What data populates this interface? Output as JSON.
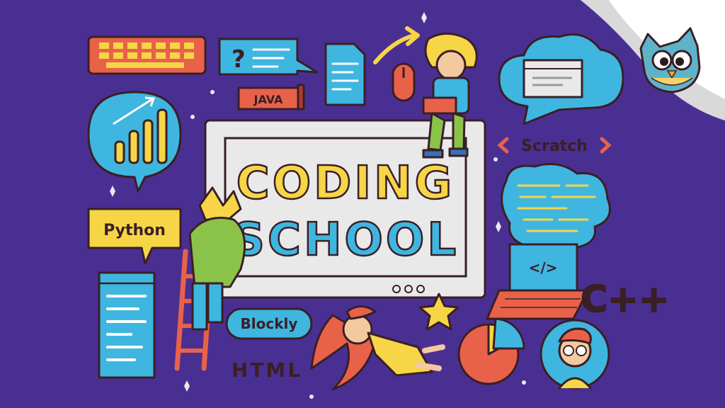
{
  "illustration": {
    "title_line1": "CODING",
    "title_line2": "SCHOOL",
    "labels": {
      "java": "JAVA",
      "scratch": "Scratch",
      "python": "Python",
      "blockly": "Blockly",
      "html": "HTML",
      "cpp": "C++",
      "question_mark": "?",
      "code_tag": "</>"
    },
    "colors": {
      "background": "#4a2f93",
      "yellow": "#f6d547",
      "blue": "#3fb6e0",
      "red": "#e8624a",
      "outline": "#3a1f25",
      "screen": "#e9e9ea"
    }
  }
}
